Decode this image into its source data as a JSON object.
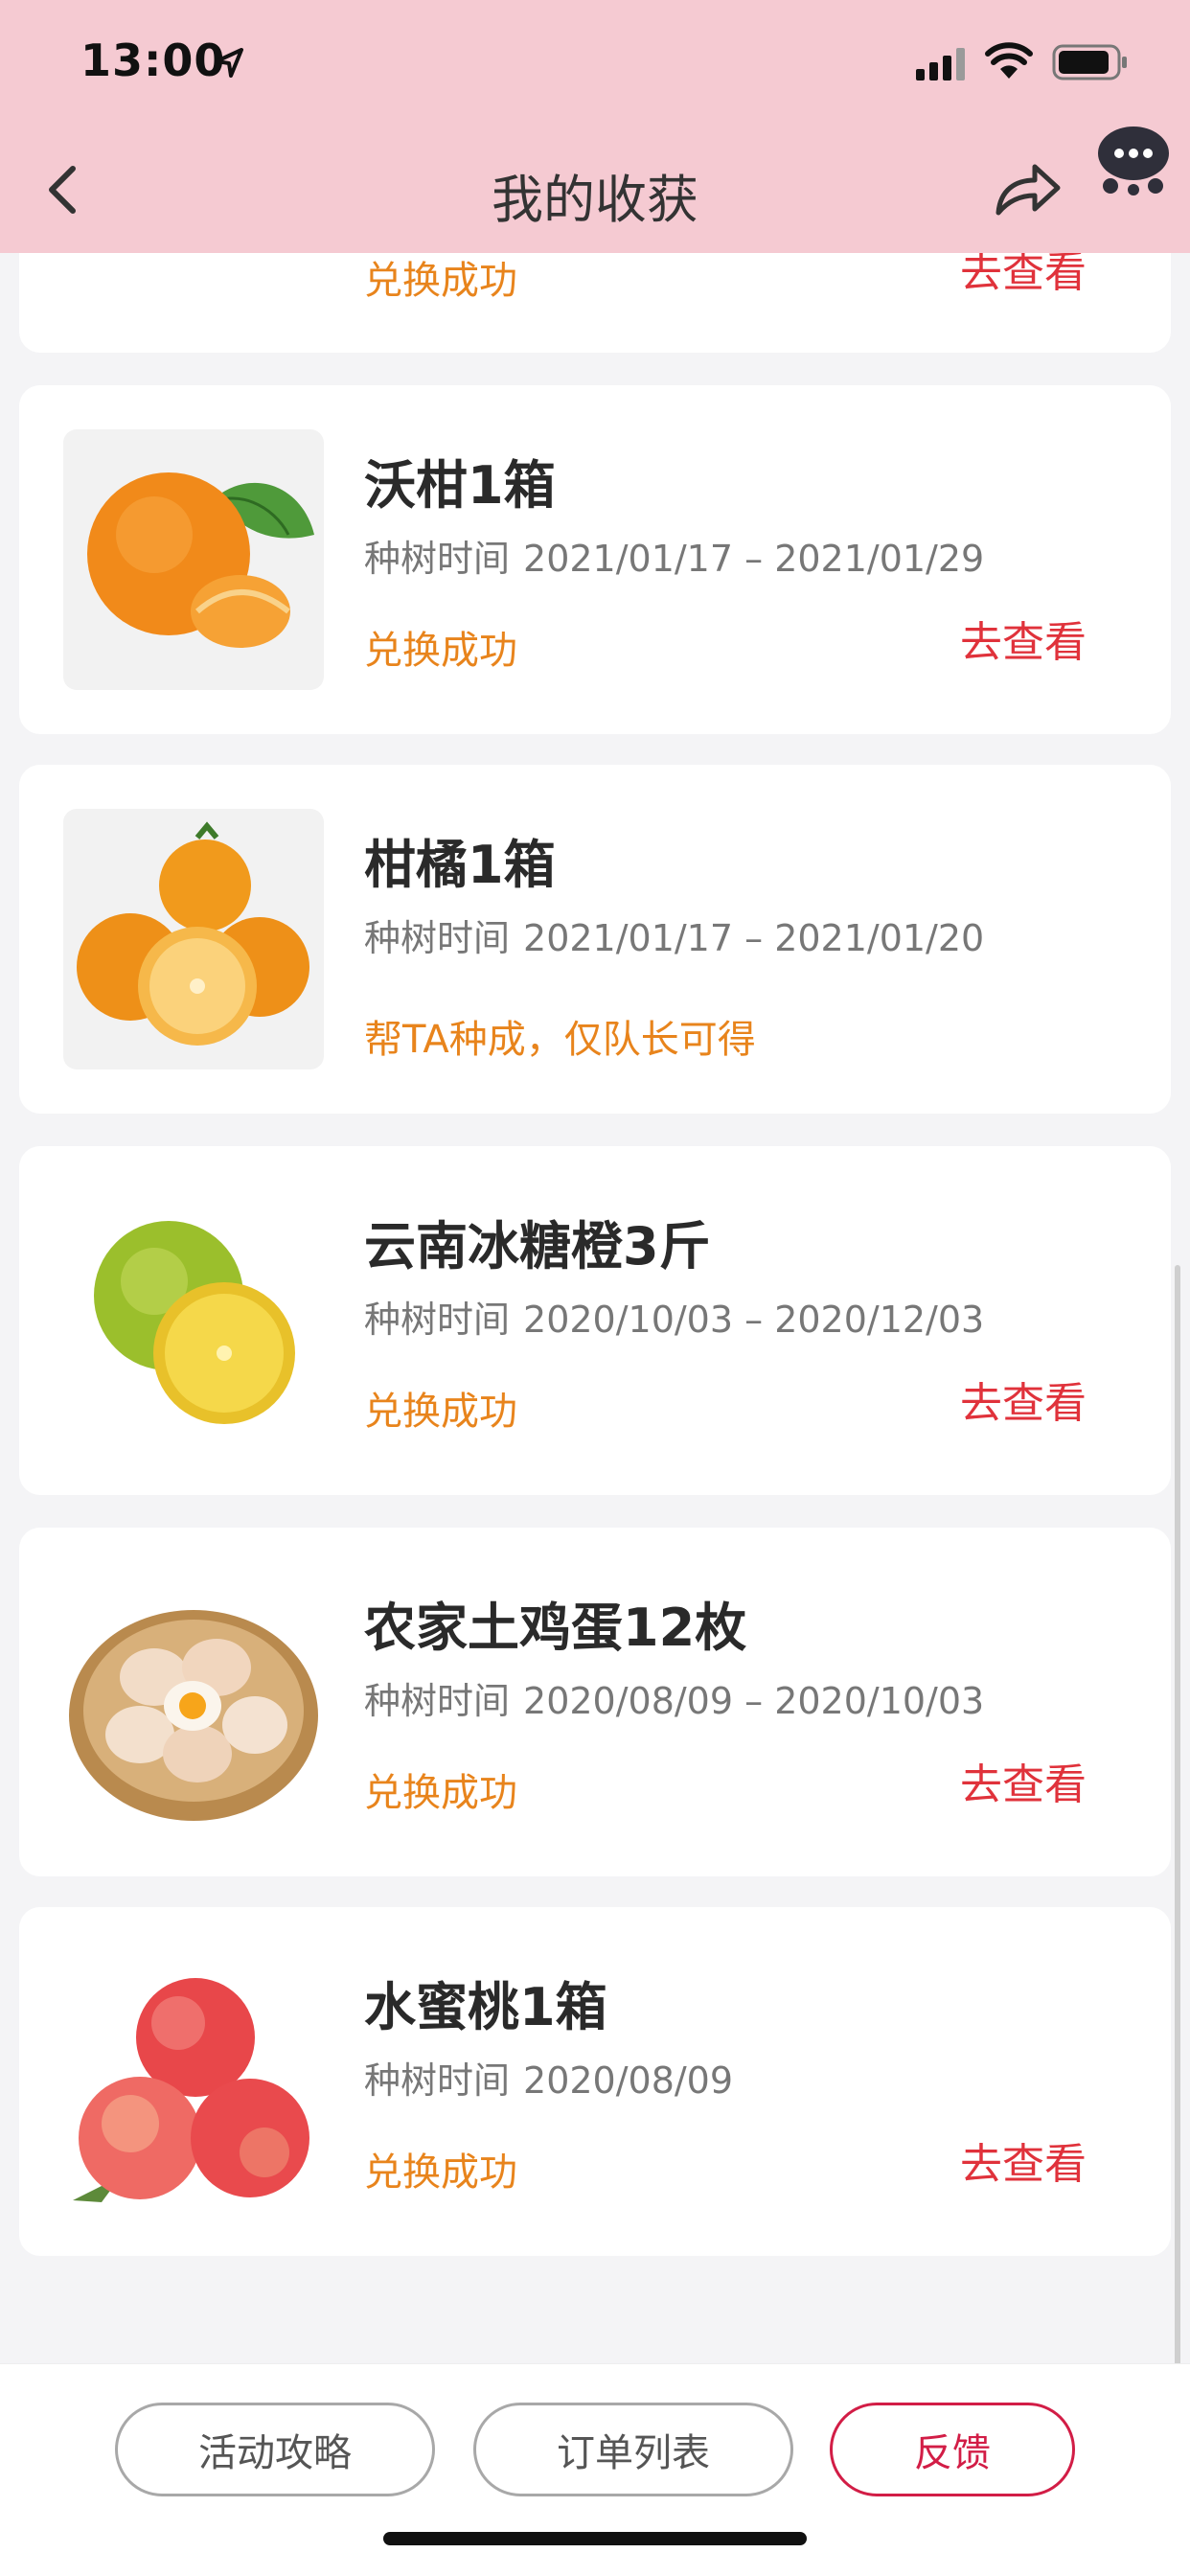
{
  "status_bar": {
    "time": "13:00"
  },
  "nav": {
    "title": "我的收获"
  },
  "list": {
    "period_label": "种树时间",
    "view_label": "去查看",
    "items": [
      {
        "title": "",
        "period": "",
        "status": "兑换成功",
        "show_view": true
      },
      {
        "title": "沃柑1箱",
        "period": "2021/01/17 – 2021/01/29",
        "status": "兑换成功",
        "show_view": true
      },
      {
        "title": "柑橘1箱",
        "period": "2021/01/17 – 2021/01/20",
        "status": "帮TA种成，仅队长可得",
        "show_view": false
      },
      {
        "title": "云南冰糖橙3斤",
        "period": "2020/10/03 – 2020/12/03",
        "status": "兑换成功",
        "show_view": true
      },
      {
        "title": "农家土鸡蛋12枚",
        "period": "2020/08/09 – 2020/10/03",
        "status": "兑换成功",
        "show_view": true
      },
      {
        "title": "水蜜桃1箱",
        "period": "2020/08/09",
        "status": "兑换成功",
        "show_view": true
      }
    ]
  },
  "bottom": {
    "guide_label": "活动攻略",
    "orders_label": "订单列表",
    "feedback_label": "反馈"
  },
  "colors": {
    "header_bg": "#f5cad2",
    "status_orange": "#e8841c",
    "link_red": "#e0323b",
    "feedback_red": "#d21d46"
  }
}
